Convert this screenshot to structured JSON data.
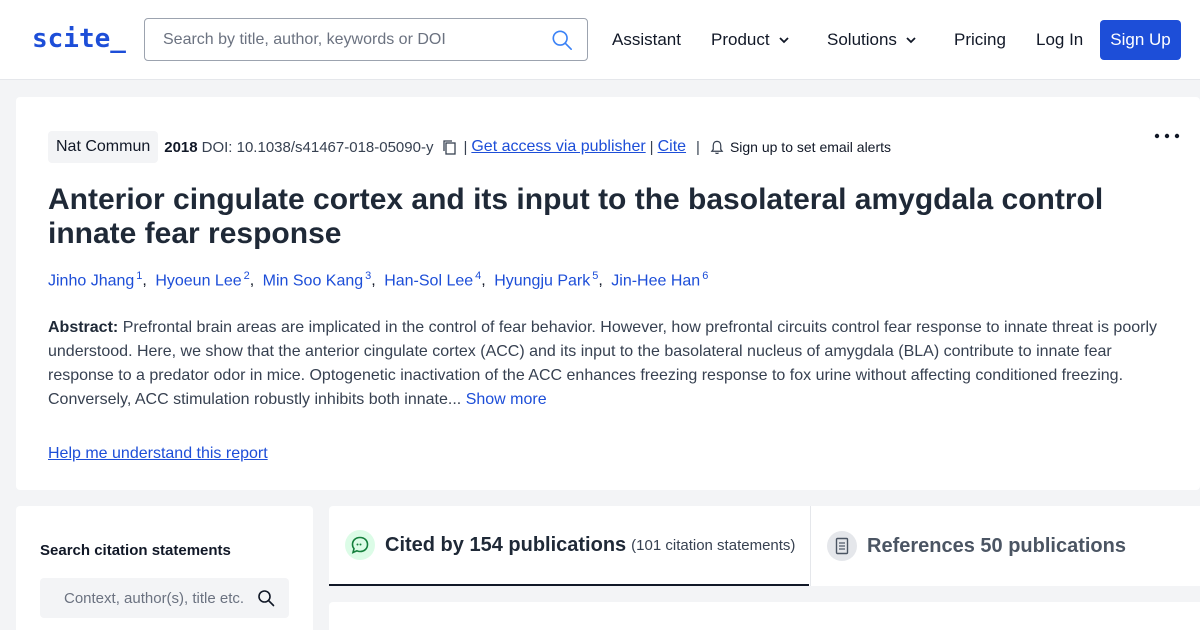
{
  "header": {
    "logo": "scite_",
    "search_placeholder": "Search by title, author, keywords or DOI",
    "nav": {
      "assistant": "Assistant",
      "product": "Product",
      "solutions": "Solutions",
      "pricing": "Pricing",
      "login": "Log In",
      "signup": "Sign Up"
    }
  },
  "paper": {
    "journal": "Nat Commun",
    "year": "2018",
    "doi": "DOI: 10.1038/s41467-018-05090-y",
    "get_access": "Get access via publisher",
    "cite": "Cite",
    "alerts": "Sign up to set email alerts",
    "title": "Anterior cingulate cortex and its input to the basolateral amygdala control innate fear response",
    "authors": [
      {
        "name": "Jinho Jhang",
        "sup": "1"
      },
      {
        "name": "Hyoeun Lee",
        "sup": "2"
      },
      {
        "name": "Min Soo Kang",
        "sup": "3"
      },
      {
        "name": "Han-Sol Lee",
        "sup": "4"
      },
      {
        "name": "Hyungju Park",
        "sup": "5"
      },
      {
        "name": "Jin-Hee Han",
        "sup": "6"
      }
    ],
    "abstract_label": "Abstract:",
    "abstract_text": "Prefrontal brain areas are implicated in the control of fear behavior. However, how prefrontal circuits control fear response to innate threat is poorly understood. Here, we show that the anterior cingulate cortex (ACC) and its input to the basolateral nucleus of amygdala (BLA) contribute to innate fear response to a predator odor in mice. Optogenetic inactivation of the ACC enhances freezing response to fox urine without affecting conditioned freezing. Conversely, ACC stimulation robustly inhibits both innate...",
    "show_more": "Show more",
    "help_link": "Help me understand this report"
  },
  "sidebar": {
    "title": "Search citation statements",
    "input_placeholder": "Context, author(s), title etc."
  },
  "tabs": {
    "cited_by": "Cited by 154 publications",
    "cited_sub": "(101 citation statements)",
    "references": "References 50 publications"
  }
}
